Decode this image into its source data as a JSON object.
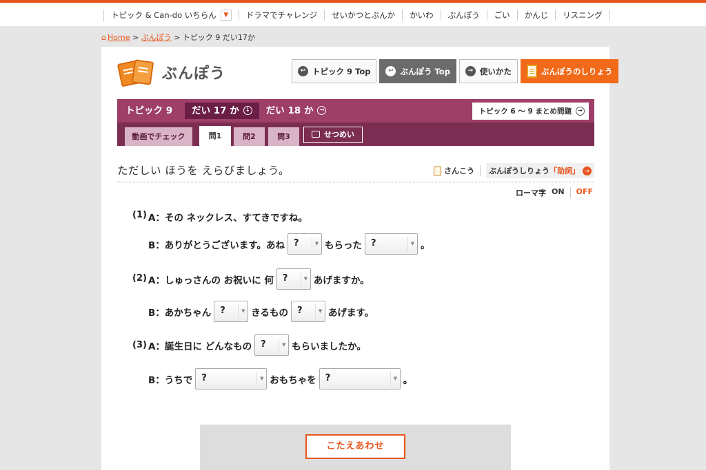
{
  "topnav": {
    "items": [
      "トピック & Can-do いちらん",
      "ドラマでチャレンジ",
      "せいかつとぶんか",
      "かいわ",
      "ぶんぽう",
      "ごい",
      "かんじ",
      "リスニング"
    ]
  },
  "breadcrumb": {
    "home": "Home",
    "sep1": ">",
    "section": "ぶんぽう",
    "sep2": ">",
    "current": "トピック 9 だい17か"
  },
  "header": {
    "logo_title": "ぶんぽう",
    "btn_topic_top": "トピック 9 Top",
    "btn_grammar_top": "ぶんぽう Top",
    "btn_usage": "使いかた",
    "btn_materials": "ぶんぽうのしりょう"
  },
  "lesson_bar": {
    "topic": "トピック 9",
    "lesson17": "だい 17 か",
    "lesson18": "だい 18 か",
    "summary": "トピック 6 〜 9 まとめ問題"
  },
  "tabs": {
    "video": "動画でチェック",
    "q1": "問1",
    "q2": "問2",
    "q3": "問3",
    "explain": "せつめい"
  },
  "instruction": "ただしい ほうを えらびましょう。",
  "reference": {
    "sankou": "さんこう",
    "grammar_prefix": "ぶんぽうしりょう",
    "grammar_highlight": "「助詞」"
  },
  "romaji": {
    "label": "ローマ字",
    "on": "ON",
    "off": "OFF"
  },
  "questions": {
    "q1": {
      "num": "(1)",
      "a_speaker": "A：",
      "a_text": "その ネックレス、すてきですね。",
      "b_speaker": "B：",
      "b_part1": "ありがとうございます。あね",
      "b_sel1": "?",
      "b_part2": "もらった",
      "b_sel2": "?",
      "b_part3": "。"
    },
    "q2": {
      "num": "(2)",
      "a_speaker": "A：",
      "a_part1": "しゅっさんの お祝いに 何",
      "a_sel1": "?",
      "a_part2": "あげますか。",
      "b_speaker": "B：",
      "b_part1": "あかちゃん",
      "b_sel1": "?",
      "b_part2": "きるもの",
      "b_sel2": "?",
      "b_part3": "あげます。"
    },
    "q3": {
      "num": "(3)",
      "a_speaker": "A：",
      "a_part1": "誕生日に どんなもの",
      "a_sel1": "?",
      "a_part2": "もらいましたか。",
      "b_speaker": "B：",
      "b_part1": "うちで",
      "b_sel1": "?",
      "b_part2": "おもちゃを",
      "b_sel2": "?",
      "b_part3": "。"
    }
  },
  "answer_button": "こたえあわせ",
  "colors": {
    "accent": "#e8541c",
    "lesson_bar": "#9e3f68",
    "tabs_bar": "#7b2d52"
  }
}
